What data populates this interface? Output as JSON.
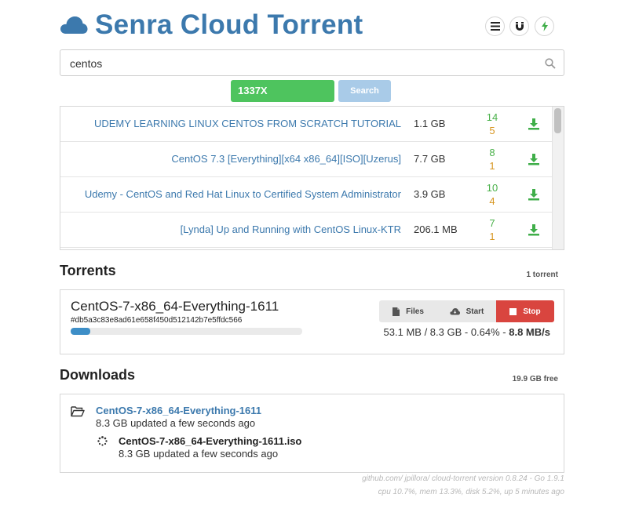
{
  "app": {
    "title": "Senra Cloud Torrent"
  },
  "header": {
    "buttons": [
      {
        "name": "list-icon"
      },
      {
        "name": "magnet-icon"
      },
      {
        "name": "bolt-icon"
      }
    ]
  },
  "search": {
    "query": "centos",
    "provider": "1337X",
    "button_label": "Search"
  },
  "results": [
    {
      "name": "UDEMY LEARNING LINUX CENTOS FROM SCRATCH TUTORIAL",
      "size": "1.1 GB",
      "seeders": "14",
      "leechers": "5"
    },
    {
      "name": "CentOS 7.3 [Everything][x64 x86_64][ISO][Uzerus]",
      "size": "7.7 GB",
      "seeders": "8",
      "leechers": "1"
    },
    {
      "name": "Udemy - CentOS and Red Hat Linux to Certified System Administrator",
      "size": "3.9 GB",
      "seeders": "10",
      "leechers": "4"
    },
    {
      "name": "[Lynda] Up and Running with CentOS Linux-KTR",
      "size": "206.1 MB",
      "seeders": "7",
      "leechers": "1"
    }
  ],
  "torrents": {
    "title": "Torrents",
    "count": "1 torrent",
    "items": [
      {
        "name": "CentOS-7-x86_64-Everything-1611",
        "hash": "#db5a3c83e8ad61e658f450d512142b7e5ffdc566",
        "progress_fraction": 0.0064,
        "files_label": "Files",
        "start_label": "Start",
        "stop_label": "Stop",
        "downloaded": "53.1 MB / 8.3 GB - 0.64% -",
        "speed": "8.8 MB/s"
      }
    ]
  },
  "downloads": {
    "title": "Downloads",
    "free": "19.9 GB free",
    "folder": {
      "name": "CentOS-7-x86_64-Everything-1611",
      "meta": "8.3 GB updated a few seconds ago"
    },
    "file": {
      "name": "CentOS-7-x86_64-Everything-1611.iso",
      "meta": "8.3 GB updated a few seconds ago"
    }
  },
  "footer": {
    "line1": "github.com/ jpillora/ cloud-torrent version 0.8.24 - Go 1.9.1",
    "line2": "cpu 10.7%, mem 13.3%, disk 5.2%, up 5 minutes ago"
  },
  "colors": {
    "brand": "#3c79ad",
    "provider": "#4ec45e",
    "seeders": "#4ab14a",
    "leechers": "#d7951f",
    "stop": "#d9453f",
    "progress": "#3d8ec7"
  }
}
